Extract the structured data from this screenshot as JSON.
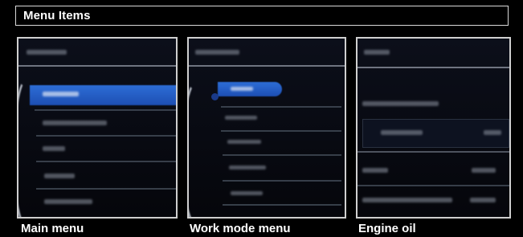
{
  "header": {
    "title": "Menu Items"
  },
  "panels": [
    {
      "caption": "Main menu"
    },
    {
      "caption": "Work mode menu"
    },
    {
      "caption": "Engine oil"
    }
  ],
  "colors": {
    "highlight": "#2d6dd6",
    "frame": "#cfcfcf",
    "background": "#000000"
  }
}
